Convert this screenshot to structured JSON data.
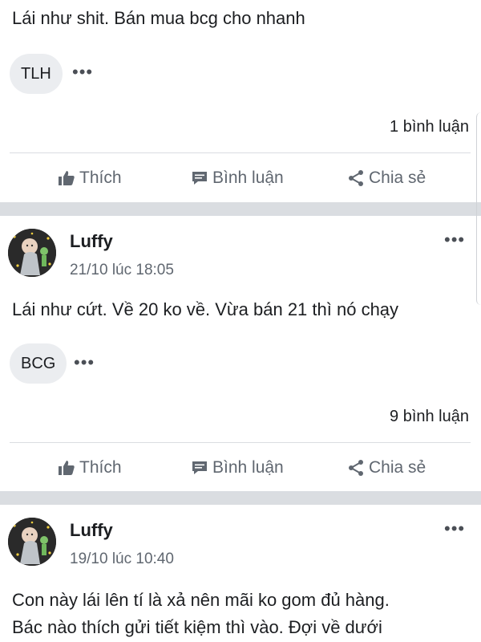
{
  "post1": {
    "text": "Lái như shit. Bán mua bcg cho nhanh",
    "tag": "TLH",
    "comments": "1 bình luận"
  },
  "post2": {
    "author": "Luffy",
    "timestamp": "21/10 lúc 18:05",
    "text": "Lái như cứt. Về 20 ko về. Vừa bán 21 thì nó chạy",
    "tag": "BCG",
    "comments": "9 bình luận"
  },
  "post3": {
    "author": "Luffy",
    "timestamp": "19/10 lúc 10:40",
    "text_line1": "Con này lái lên tí là xả nên mãi ko gom đủ hàng.",
    "text_line2": "Bác nào thích gửi tiết kiệm thì vào. Đợi về dưới"
  },
  "actions": {
    "like": "Thích",
    "comment": "Bình luận",
    "share": "Chia sẻ"
  },
  "icons": {
    "more": "more-horizontal-icon",
    "like": "thumbs-up-icon",
    "comment": "comment-icon",
    "share": "share-icon"
  }
}
